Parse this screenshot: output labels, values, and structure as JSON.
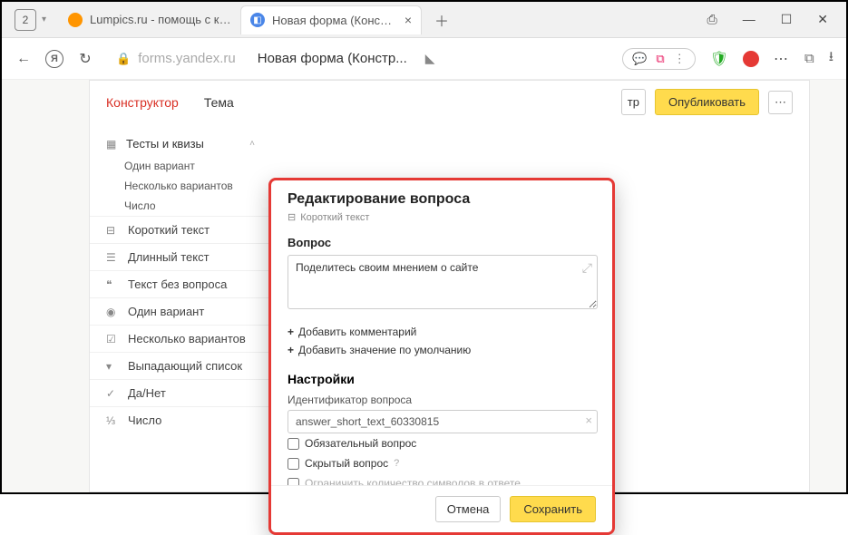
{
  "browser": {
    "tab_count": "2",
    "tabs": [
      {
        "label": "Lumpics.ru - помощь с кол",
        "active": false
      },
      {
        "label": "Новая форма (Констру",
        "active": true
      }
    ],
    "url_host": "forms.yandex.ru",
    "page_title_bar": "Новая форма (Констр..."
  },
  "page": {
    "tabs": {
      "constructor": "Конструктор",
      "theme": "Тема"
    },
    "preview_btn": "тр",
    "publish_btn": "Опубликовать"
  },
  "sidebar": {
    "group": "Тесты и квизы",
    "subs": [
      "Один вариант",
      "Несколько вариантов",
      "Число"
    ],
    "items": [
      "Короткий текст",
      "Длинный текст",
      "Текст без вопроса",
      "Один вариант",
      "Несколько вариантов",
      "Выпадающий список",
      "Да/Нет",
      "Число"
    ]
  },
  "modal": {
    "title": "Редактирование вопроса",
    "type_label": "Короткий текст",
    "question_label": "Вопрос",
    "question_value": "Поделитесь своим мнением о сайте",
    "add_comment": "Добавить комментарий",
    "add_default": "Добавить значение по умолчанию",
    "settings_h": "Настройки",
    "id_label": "Идентификатор вопроса",
    "id_value": "answer_short_text_60330815",
    "chk_required": "Обязательный вопрос",
    "chk_hidden": "Скрытый вопрос",
    "chk_limit": "Ограничить количество символов в ответе",
    "cancel": "Отмена",
    "save": "Сохранить"
  }
}
